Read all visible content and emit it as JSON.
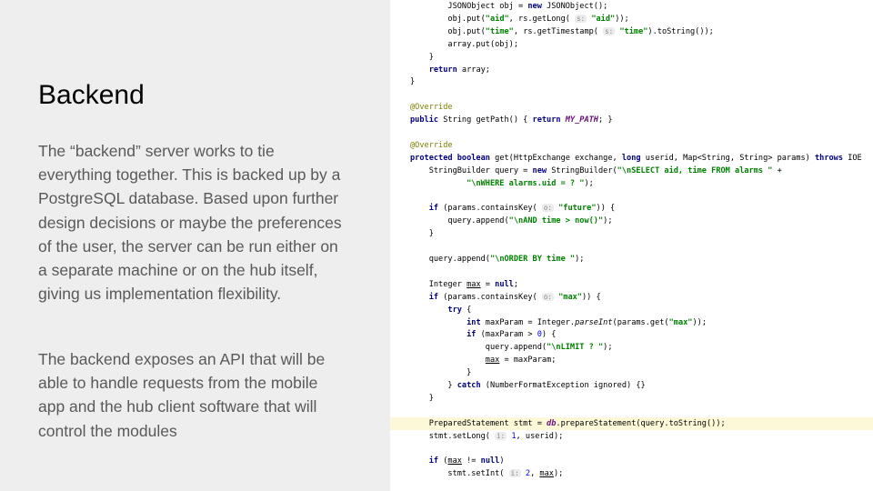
{
  "slide": {
    "title": "Backend",
    "paragraphs": [
      "The “backend” server works to tie everything together. This is backed up by a PostgreSQL database. Based upon further design decisions or maybe the preferences of the user, the server can be run either on a separate machine or on the hub itself, giving us implementation flexibility.",
      "The backend exposes an API that will be able to handle requests from the mobile app and the hub client software that will control the modules"
    ]
  },
  "code": {
    "highlighted_line": 33,
    "lines": [
      [
        {
          "t": "        JSONObject obj = "
        },
        {
          "t": "new",
          "c": "kw"
        },
        {
          "t": " JSONObject();"
        }
      ],
      [
        {
          "t": "        obj.put("
        },
        {
          "t": "\"aid\"",
          "c": "str"
        },
        {
          "t": ", rs.getLong( "
        },
        {
          "t": "s:",
          "c": "hint"
        },
        {
          "t": " "
        },
        {
          "t": "\"aid\"",
          "c": "str"
        },
        {
          "t": "));"
        }
      ],
      [
        {
          "t": "        obj.put("
        },
        {
          "t": "\"time\"",
          "c": "str"
        },
        {
          "t": ", rs.getTimestamp( "
        },
        {
          "t": "s:",
          "c": "hint"
        },
        {
          "t": " "
        },
        {
          "t": "\"time\"",
          "c": "str"
        },
        {
          "t": ").toString());"
        }
      ],
      [
        {
          "t": "        array.put(obj);"
        }
      ],
      [
        {
          "t": "    }"
        }
      ],
      [
        {
          "t": "    "
        },
        {
          "t": "return",
          "c": "kw"
        },
        {
          "t": " array;"
        }
      ],
      [
        {
          "t": "}"
        }
      ],
      [],
      [
        {
          "t": "@Override",
          "c": "ann"
        }
      ],
      [
        {
          "t": "public",
          "c": "kw"
        },
        {
          "t": " String getPath() { "
        },
        {
          "t": "return",
          "c": "kw"
        },
        {
          "t": " "
        },
        {
          "t": "MY_PATH",
          "c": "fld"
        },
        {
          "t": "; }"
        }
      ],
      [],
      [
        {
          "t": "@Override",
          "c": "ann"
        }
      ],
      [
        {
          "t": "protected boolean",
          "c": "kw"
        },
        {
          "t": " get(HttpExchange exchange, "
        },
        {
          "t": "long",
          "c": "kw"
        },
        {
          "t": " userid, Map<String, String> params) "
        },
        {
          "t": "throws",
          "c": "kw"
        },
        {
          "t": " IOE"
        }
      ],
      [
        {
          "t": "    StringBuilder query = "
        },
        {
          "t": "new",
          "c": "kw"
        },
        {
          "t": " StringBuilder("
        },
        {
          "t": "\"\\nSELECT aid, time FROM alarms \"",
          "c": "str"
        },
        {
          "t": " +"
        }
      ],
      [
        {
          "t": "            "
        },
        {
          "t": "\"\\nWHERE alarms.uid = ? \"",
          "c": "str"
        },
        {
          "t": ");"
        }
      ],
      [],
      [
        {
          "t": "    "
        },
        {
          "t": "if",
          "c": "kw"
        },
        {
          "t": " (params.containsKey( "
        },
        {
          "t": "o:",
          "c": "hint"
        },
        {
          "t": " "
        },
        {
          "t": "\"future\"",
          "c": "str"
        },
        {
          "t": ")) {"
        }
      ],
      [
        {
          "t": "        query.append("
        },
        {
          "t": "\"\\nAND time > now()\"",
          "c": "str"
        },
        {
          "t": ");"
        }
      ],
      [
        {
          "t": "    }"
        }
      ],
      [],
      [
        {
          "t": "    query.append("
        },
        {
          "t": "\"\\nORDER BY time \"",
          "c": "str"
        },
        {
          "t": ");"
        }
      ],
      [],
      [
        {
          "t": "    Integer "
        },
        {
          "t": "max",
          "c": "und"
        },
        {
          "t": " = "
        },
        {
          "t": "null",
          "c": "kw"
        },
        {
          "t": ";"
        }
      ],
      [
        {
          "t": "    "
        },
        {
          "t": "if",
          "c": "kw"
        },
        {
          "t": " (params.containsKey( "
        },
        {
          "t": "o:",
          "c": "hint"
        },
        {
          "t": " "
        },
        {
          "t": "\"max\"",
          "c": "str"
        },
        {
          "t": ")) {"
        }
      ],
      [
        {
          "t": "        "
        },
        {
          "t": "try",
          "c": "kw"
        },
        {
          "t": " {"
        }
      ],
      [
        {
          "t": "            "
        },
        {
          "t": "int",
          "c": "kw"
        },
        {
          "t": " maxParam = Integer."
        },
        {
          "t": "parseInt",
          "c": "ital"
        },
        {
          "t": "(params.get("
        },
        {
          "t": "\"max\"",
          "c": "str"
        },
        {
          "t": "));"
        }
      ],
      [
        {
          "t": "            "
        },
        {
          "t": "if",
          "c": "kw"
        },
        {
          "t": " (maxParam > "
        },
        {
          "t": "0",
          "c": "num"
        },
        {
          "t": ") {"
        }
      ],
      [
        {
          "t": "                query.append("
        },
        {
          "t": "\"\\nLIMIT ? \"",
          "c": "str"
        },
        {
          "t": ");"
        }
      ],
      [
        {
          "t": "                "
        },
        {
          "t": "max",
          "c": "und"
        },
        {
          "t": " = maxParam;"
        }
      ],
      [
        {
          "t": "            }"
        }
      ],
      [
        {
          "t": "        } "
        },
        {
          "t": "catch",
          "c": "kw"
        },
        {
          "t": " (NumberFormatException ignored) {}"
        }
      ],
      [
        {
          "t": "    }"
        }
      ],
      [],
      [
        {
          "t": "    PreparedStatement stmt = "
        },
        {
          "t": "db",
          "c": "fld"
        },
        {
          "t": ".prepareStatement(query.toString());"
        }
      ],
      [
        {
          "t": "    stmt.setLong( "
        },
        {
          "t": "i:",
          "c": "hint"
        },
        {
          "t": " "
        },
        {
          "t": "1",
          "c": "num"
        },
        {
          "t": ", userid);"
        }
      ],
      [],
      [
        {
          "t": "    "
        },
        {
          "t": "if",
          "c": "kw"
        },
        {
          "t": " ("
        },
        {
          "t": "max",
          "c": "und"
        },
        {
          "t": " != "
        },
        {
          "t": "null",
          "c": "kw"
        },
        {
          "t": ")"
        }
      ],
      [
        {
          "t": "        stmt.setInt( "
        },
        {
          "t": "i:",
          "c": "hint"
        },
        {
          "t": " "
        },
        {
          "t": "2",
          "c": "num"
        },
        {
          "t": ", "
        },
        {
          "t": "max",
          "c": "und"
        },
        {
          "t": ");"
        }
      ]
    ]
  }
}
